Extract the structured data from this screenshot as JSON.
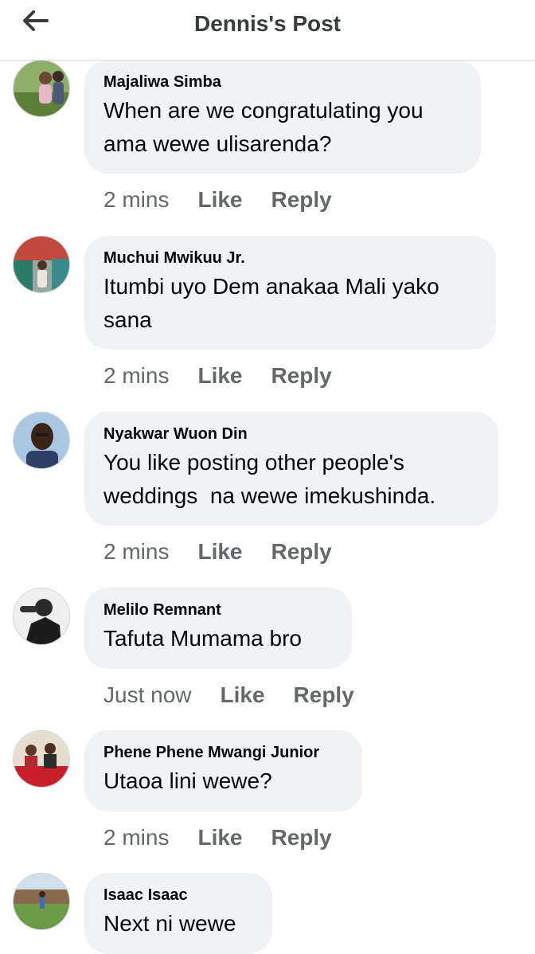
{
  "header": {
    "title": "Dennis's Post",
    "back_icon": "arrow-left-icon"
  },
  "comments": [
    {
      "author": "Majaliwa Simba",
      "text": "When are we congratulating you ama wewe ulisarenda?",
      "time": "2 mins",
      "like": "Like",
      "reply": "Reply"
    },
    {
      "author": "Muchui Mwikuu Jr.",
      "text": "Itumbi uyo Dem anakaa Mali yako sana",
      "time": "2 mins",
      "like": "Like",
      "reply": "Reply"
    },
    {
      "author": "Nyakwar Wuon Din",
      "text": "You like posting other people's weddings  na wewe imekushinda.",
      "time": "2 mins",
      "like": "Like",
      "reply": "Reply"
    },
    {
      "author": "Melilo Remnant",
      "text": "Tafuta Mumama bro",
      "time": "Just now",
      "like": "Like",
      "reply": "Reply"
    },
    {
      "author": "Phene Phene Mwangi Junior",
      "text": "Utaoa lini wewe?",
      "time": "2 mins",
      "like": "Like",
      "reply": "Reply"
    },
    {
      "author": "Isaac Isaac",
      "text": "Next ni wewe"
    }
  ],
  "colors": {
    "bubble": "#f0f2f5",
    "secondary_text": "#65676b",
    "divider": "#dadde1"
  }
}
